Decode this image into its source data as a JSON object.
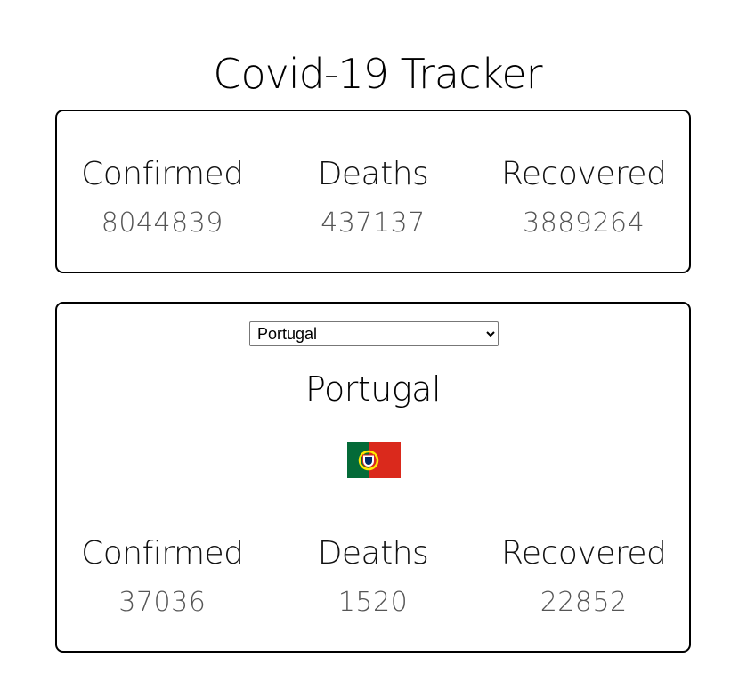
{
  "page": {
    "title": "Covid-19 Tracker"
  },
  "global": {
    "confirmed_label": "Confirmed",
    "confirmed_value": "8044839",
    "deaths_label": "Deaths",
    "deaths_value": "437137",
    "recovered_label": "Recovered",
    "recovered_value": "3889264"
  },
  "country": {
    "selected": "Portugal",
    "name": "Portugal",
    "flag_icon": "portugal-flag",
    "flag_colors": {
      "green": "#046a38",
      "red": "#da291c",
      "gold": "#ffe900"
    },
    "confirmed_label": "Confirmed",
    "confirmed_value": "37036",
    "deaths_label": "Deaths",
    "deaths_value": "1520",
    "recovered_label": "Recovered",
    "recovered_value": "22852"
  }
}
